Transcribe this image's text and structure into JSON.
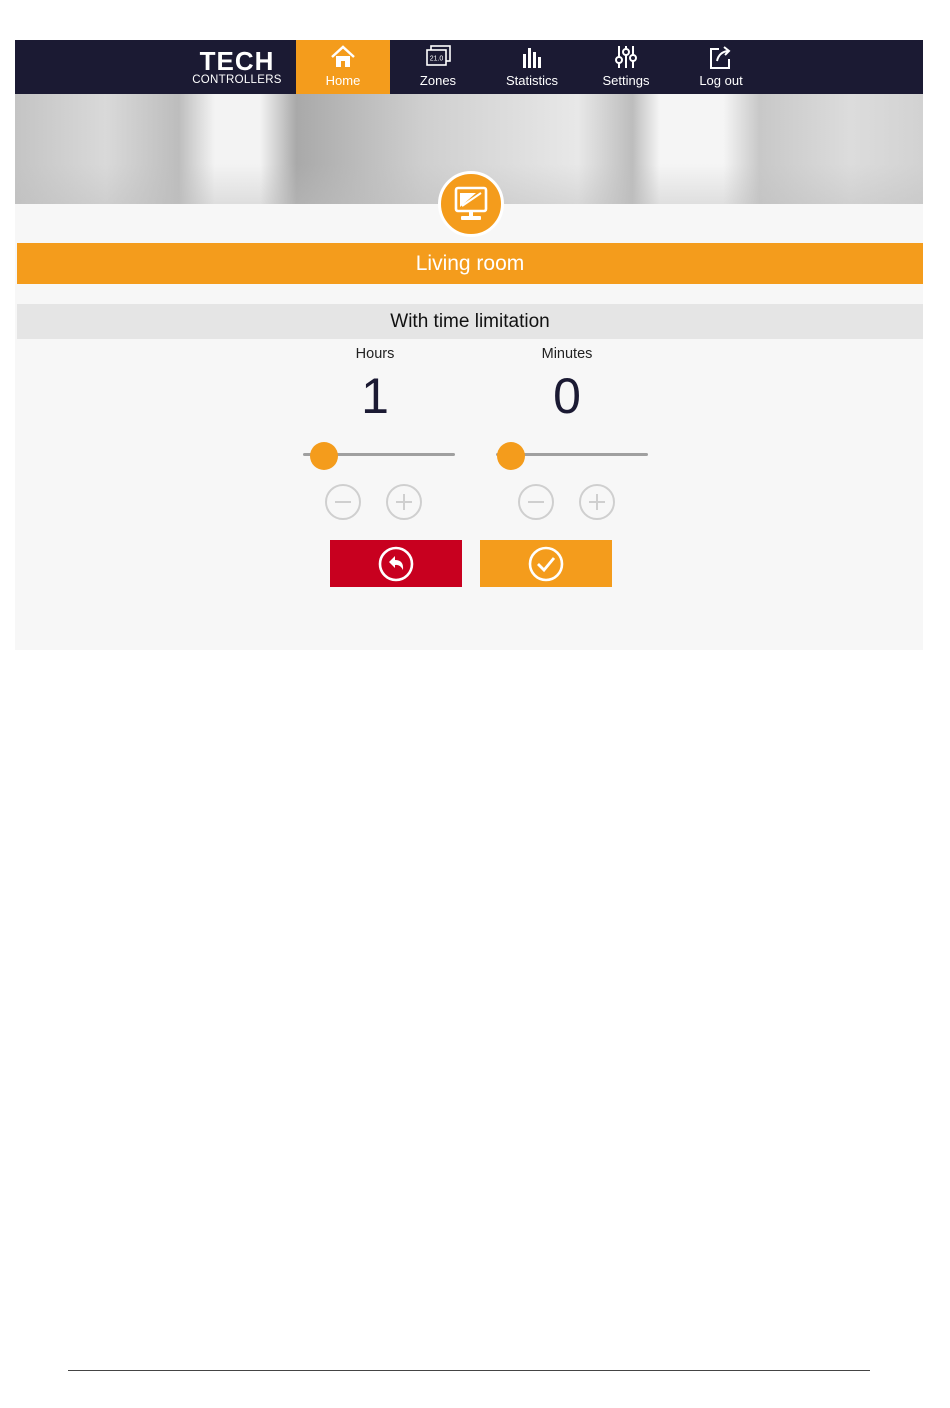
{
  "brand": {
    "line1": "TECH",
    "line2": "CONTROLLERS"
  },
  "nav": {
    "items": [
      {
        "label": "Home",
        "icon": "home-icon",
        "active": true
      },
      {
        "label": "Zones",
        "icon": "zones-icon",
        "active": false
      },
      {
        "label": "Statistics",
        "icon": "statistics-icon",
        "active": false
      },
      {
        "label": "Settings",
        "icon": "settings-sliders-icon",
        "active": false
      },
      {
        "label": "Log out",
        "icon": "logout-icon",
        "active": false
      }
    ],
    "zones_icon_text": "21.0"
  },
  "room": {
    "name": "Living room",
    "icon": "room-thermostat-icon"
  },
  "mode": {
    "title": "With time limitation"
  },
  "timer": {
    "hours": {
      "label": "Hours",
      "value": "1",
      "slider_fraction": 0.14
    },
    "minutes": {
      "label": "Minutes",
      "value": "0",
      "slider_fraction": 0.1
    }
  },
  "actions": {
    "back_icon": "undo-icon",
    "confirm_icon": "check-circle-icon"
  },
  "colors": {
    "nav_bg": "#1b1a33",
    "accent": "#f49c1c",
    "cancel": "#c8001f",
    "panel_bg": "#f7f7f7"
  }
}
